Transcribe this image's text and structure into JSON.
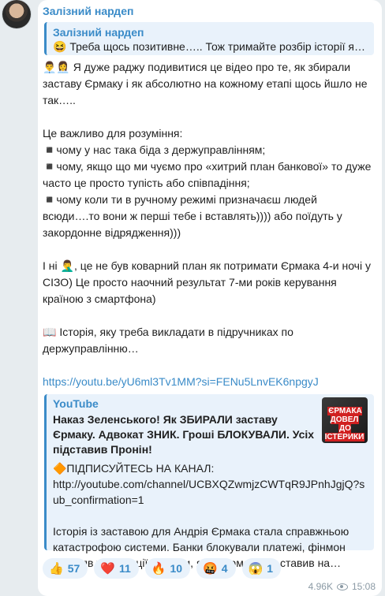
{
  "sender": "Залізний нардеп",
  "reply": {
    "title": "Залізний нардеп",
    "text": "😆 Треба щось позитивне….. Тож тримайте розбір історії як …"
  },
  "body": {
    "p1": "👨‍💼👩‍💼 Я дуже раджу подивитися це відео про те, як збирали заставу Єрмаку і як абсолютно на кожному етапі щось йшло не так…..",
    "p2": "Це важливо для розуміння:",
    "p3": "◾️чому у нас така біда з держуправлінням;",
    "p4": "◾️чому, якщо що ми чуємо про «хитрий план банкової» то дуже часто це просто тупість або співпадіння;",
    "p5": "◾️чому коли ти в ручному режимі призначаєш людей всюди….то вони ж перші тебе і вставлять)))) або поїдуть у закордонне відрядження)))",
    "p6": "І ні 🤦‍♂️, це не був коварний план як потримати Єрмака 4-и ночі у СІЗО) Це просто наочний результат 7-ми років керування країною з смартфона)",
    "p7": "📖 Історія, яку треба викладати в підручниках по держуправлінню…",
    "link": "https://youtu.be/yU6ml3Tv1MM?si=FENu5LnvEK6npgyJ"
  },
  "preview": {
    "site": "YouTube",
    "title": "Наказ Зеленського! Як ЗБИРАЛИ заставу Єрмаку. Адвокат ЗНИК. Гроші БЛОКУВАЛИ. Усіх підставив Пронін!",
    "line1": "🔶ПІДПИСУЙТЕСЬ НА КАНАЛ:",
    "line2": "http://youtube.com/channel/UCBXQZwmjzCWTqR9JPnhJgjQ?sub_confirmation=1",
    "desc": "Історія із заставою для Андрія Єрмака стала справжньою катастрофою системи. Банки блокували платежі, фінмон зупиняв транзакції, а люди, яких Єрмак сам ставив на…",
    "thumb_caption_1": "ЄРМАКА ДОВЕЛ",
    "thumb_caption_2": "ДО ІСТЕРИКИ"
  },
  "reactions": [
    {
      "emoji": "👍",
      "count": "57"
    },
    {
      "emoji": "❤️",
      "count": "11"
    },
    {
      "emoji": "🔥",
      "count": "10"
    },
    {
      "emoji": "🤬",
      "count": "4"
    },
    {
      "emoji": "😱",
      "count": "1"
    }
  ],
  "meta": {
    "views": "4.96K",
    "time": "15:08"
  }
}
